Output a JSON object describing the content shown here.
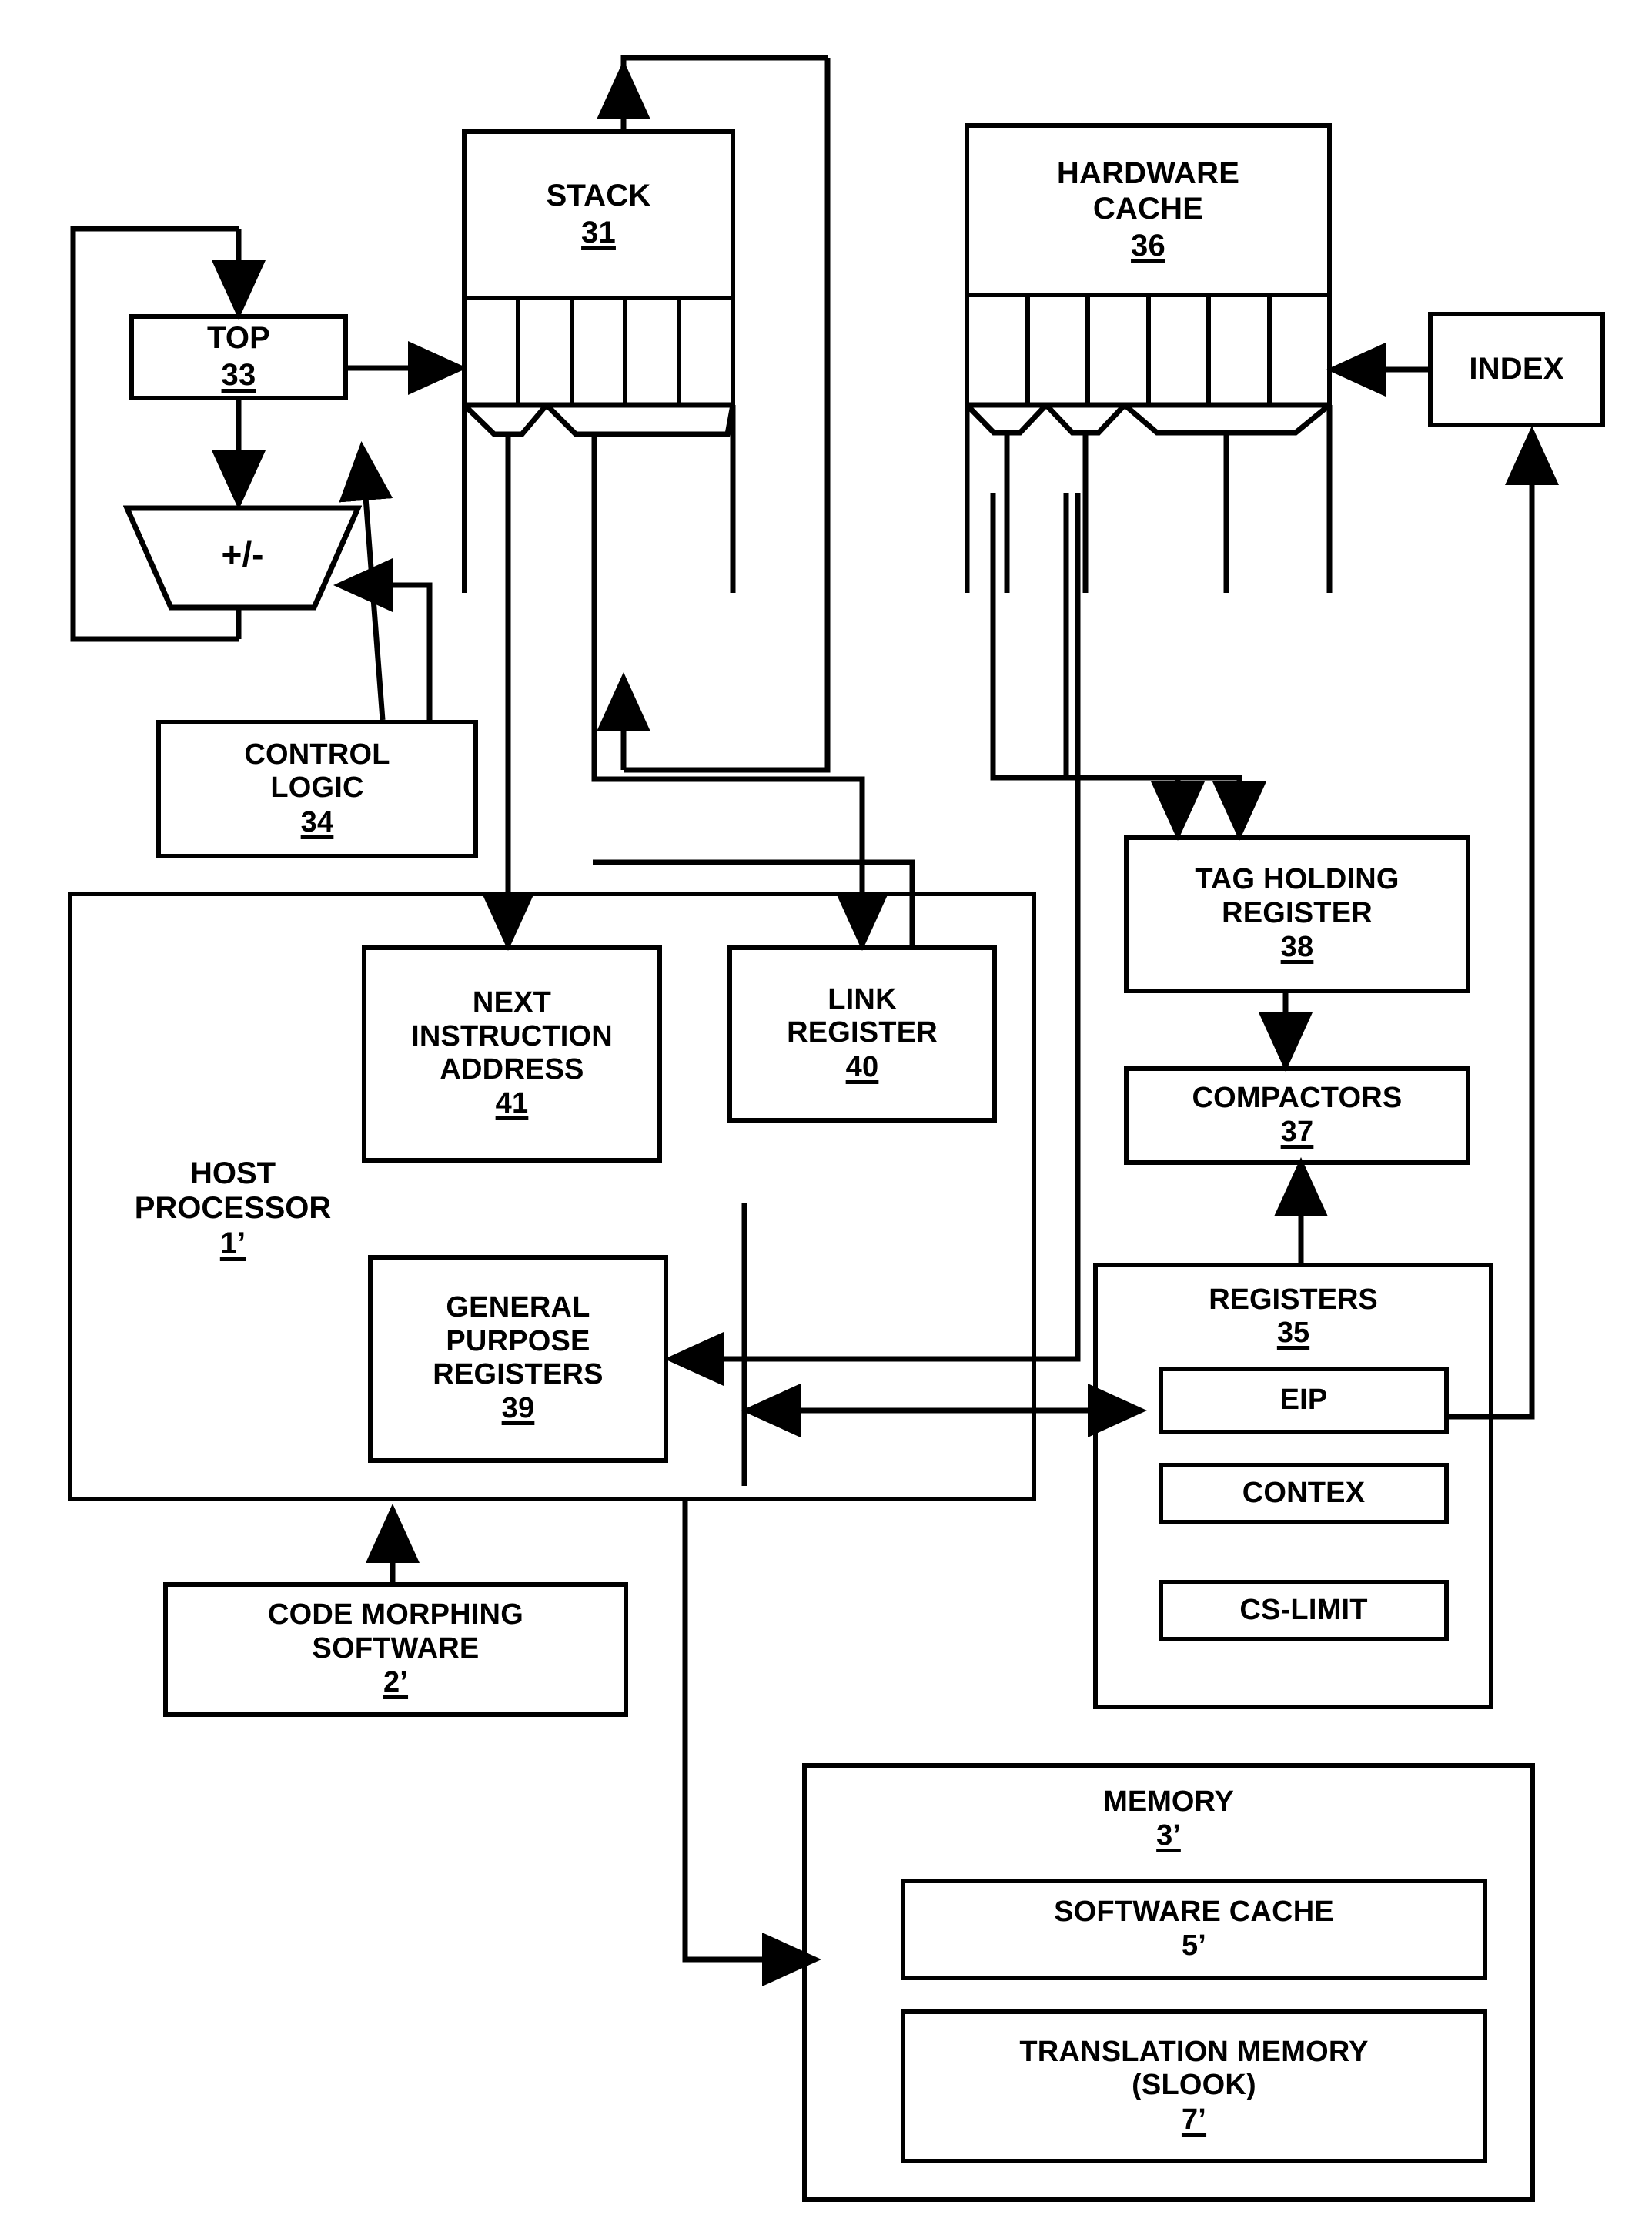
{
  "figure": {
    "kind": "patent-block-diagram",
    "line_color": "#000000",
    "background": "#ffffff"
  },
  "blocks": {
    "stack": {
      "title": "STACK",
      "ref": "31",
      "cells": 5
    },
    "top": {
      "title": "TOP",
      "ref": "33"
    },
    "alu": {
      "title": "+/-"
    },
    "control_logic": {
      "line1": "CONTROL",
      "line2": "LOGIC",
      "ref": "34"
    },
    "hardware_cache": {
      "line1": "HARDWARE",
      "line2": "CACHE",
      "ref": "36",
      "cells": 6
    },
    "index": {
      "title": "INDEX"
    },
    "tag_holding_register": {
      "line1": "TAG HOLDING",
      "line2": "REGISTER",
      "ref": "38"
    },
    "compactors": {
      "title": "COMPACTORS",
      "ref": "37"
    },
    "registers": {
      "title": "REGISTERS",
      "ref": "35",
      "items": [
        {
          "label": "EIP"
        },
        {
          "label": "CONTEX"
        },
        {
          "label": "CS-LIMIT"
        }
      ]
    },
    "host_processor": {
      "line1": "HOST",
      "line2": "PROCESSOR",
      "ref": "1’"
    },
    "next_instruction_address": {
      "line1": "NEXT",
      "line2": "INSTRUCTION",
      "line3": "ADDRESS",
      "ref": "41"
    },
    "link_register": {
      "line1": "LINK",
      "line2": "REGISTER",
      "ref": "40"
    },
    "general_purpose_registers": {
      "line1": "GENERAL",
      "line2": "PURPOSE",
      "line3": "REGISTERS",
      "ref": "39"
    },
    "code_morphing_software": {
      "line1": "CODE MORPHING",
      "line2": "SOFTWARE",
      "ref": "2’"
    },
    "memory": {
      "title": "MEMORY",
      "ref": "3’",
      "software_cache": {
        "title": "SOFTWARE CACHE",
        "ref": "5’"
      },
      "translation_memory": {
        "line1": "TRANSLATION MEMORY",
        "line2": "(SLOOK)",
        "ref": "7’"
      }
    }
  }
}
